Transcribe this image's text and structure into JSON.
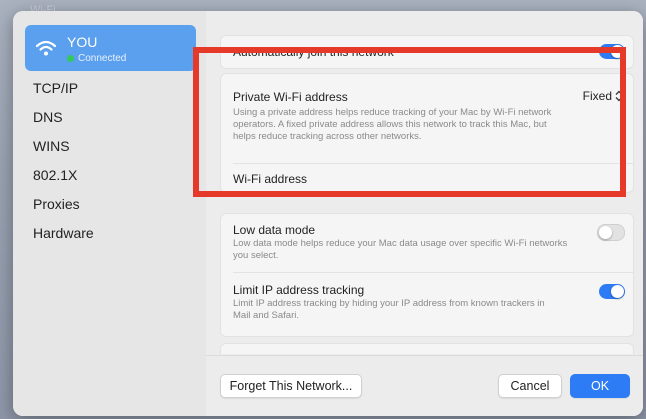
{
  "background": {
    "window_title": "Wi-Fi"
  },
  "network": {
    "name": "YOU",
    "status": "Connected"
  },
  "sidebar": {
    "items": [
      {
        "label": "TCP/IP"
      },
      {
        "label": "DNS"
      },
      {
        "label": "WINS"
      },
      {
        "label": "802.1X"
      },
      {
        "label": "Proxies"
      },
      {
        "label": "Hardware"
      }
    ]
  },
  "settings": {
    "auto_join": {
      "label": "Automatically join this network",
      "enabled": true
    },
    "private_address": {
      "label": "Private Wi-Fi address",
      "value": "Fixed",
      "description": "Using a private address helps reduce tracking of your Mac by Wi-Fi network operators. A fixed private address allows this network to track this Mac, but helps reduce tracking across other networks."
    },
    "wifi_address": {
      "label": "Wi-Fi address",
      "value": ":"
    },
    "low_data": {
      "label": "Low data mode",
      "description": "Low data mode helps reduce your Mac data usage over specific Wi-Fi networks you select.",
      "enabled": false
    },
    "limit_ip": {
      "label": "Limit IP address tracking",
      "description": "Limit IP address tracking by hiding your IP address from known trackers in Mail and Safari.",
      "enabled": true
    }
  },
  "footer": {
    "forget_label": "Forget This Network...",
    "cancel_label": "Cancel",
    "ok_label": "OK"
  },
  "colors": {
    "accent": "#2d7cf5",
    "highlight": "#e5392a",
    "connected": "#34c759"
  }
}
